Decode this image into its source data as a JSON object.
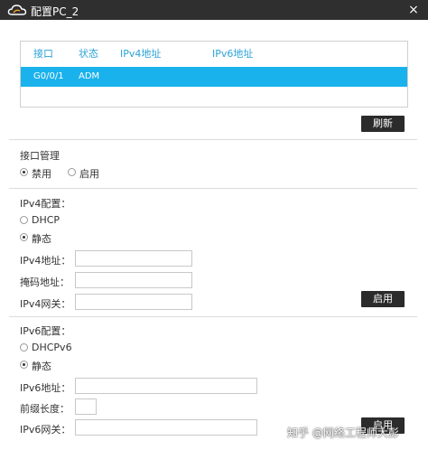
{
  "window": {
    "title": "配置PC_2",
    "close_glyph": "×"
  },
  "interface_table": {
    "columns": [
      "接口",
      "状态",
      "IPv4地址",
      "IPv6地址"
    ],
    "rows": [
      {
        "interface": "G0/0/1",
        "status": "ADM",
        "ipv4": "",
        "ipv6": ""
      }
    ],
    "selected_color": "#1ab2ec"
  },
  "refresh_button": "刷新",
  "interface_mgmt": {
    "label": "接口管理",
    "options": [
      {
        "label": "禁用",
        "selected": true
      },
      {
        "label": "启用",
        "selected": false
      }
    ]
  },
  "ipv4": {
    "label": "IPv4配置：",
    "options": [
      {
        "label": "DHCP",
        "selected": false
      },
      {
        "label": "静态",
        "selected": true
      }
    ],
    "fields": {
      "address_label": "IPv4地址：",
      "address_value": "",
      "mask_label": "掩码地址：",
      "mask_value": "",
      "gateway_label": "IPv4网关：",
      "gateway_value": ""
    },
    "apply_button": "启用"
  },
  "ipv6": {
    "label": "IPv6配置：",
    "options": [
      {
        "label": "DHCPv6",
        "selected": false
      },
      {
        "label": "静态",
        "selected": true
      }
    ],
    "fields": {
      "address_label": "IPv6地址：",
      "address_value": "",
      "prefix_label": "前缀长度：",
      "prefix_value": "",
      "gateway_label": "IPv6网关：",
      "gateway_value": ""
    },
    "apply_button": "启用"
  },
  "watermark": "知乎 @网络工程师大彭",
  "colors": {
    "titlebar": "#2f2f2f",
    "accent": "#1ab2ec",
    "header_text": "#2ba3d6",
    "button": "#2b2b2b"
  }
}
